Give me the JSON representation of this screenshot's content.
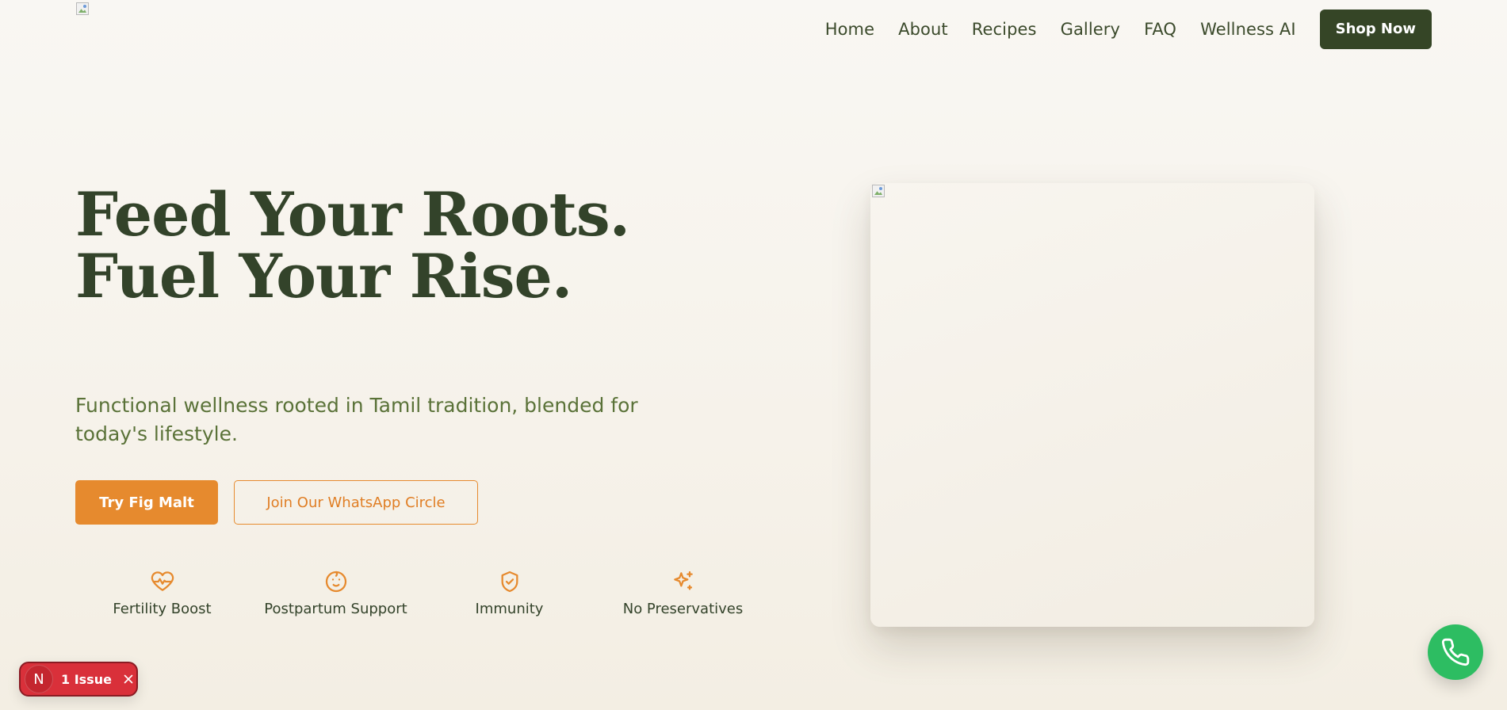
{
  "header": {
    "logo_alt": "",
    "nav": [
      {
        "label": "Home"
      },
      {
        "label": "About"
      },
      {
        "label": "Recipes"
      },
      {
        "label": "Gallery"
      },
      {
        "label": "FAQ"
      },
      {
        "label": "Wellness AI"
      }
    ],
    "cta_label": "Shop Now"
  },
  "hero": {
    "title": "Feed Your Roots. Fuel Your Rise.",
    "subtitle": "Functional wellness rooted in Tamil tradition, blended for today's lifestyle.",
    "primary_cta": "Try Fig Malt",
    "secondary_cta": "Join Our WhatsApp Circle",
    "features": [
      {
        "label": "Fertility Boost",
        "icon": "heart-pulse-icon"
      },
      {
        "label": "Postpartum Support",
        "icon": "baby-face-icon"
      },
      {
        "label": "Immunity",
        "icon": "shield-check-icon"
      },
      {
        "label": "No Preservatives",
        "icon": "sparkles-icon"
      }
    ]
  },
  "dev_overlay": {
    "badge_letter": "N",
    "issues_label": "1 Issue"
  },
  "colors": {
    "brand_dark": "#354526",
    "accent_orange": "#e68a2e",
    "whatsapp_green": "#2dbd62",
    "issue_red": "#d9303a"
  }
}
